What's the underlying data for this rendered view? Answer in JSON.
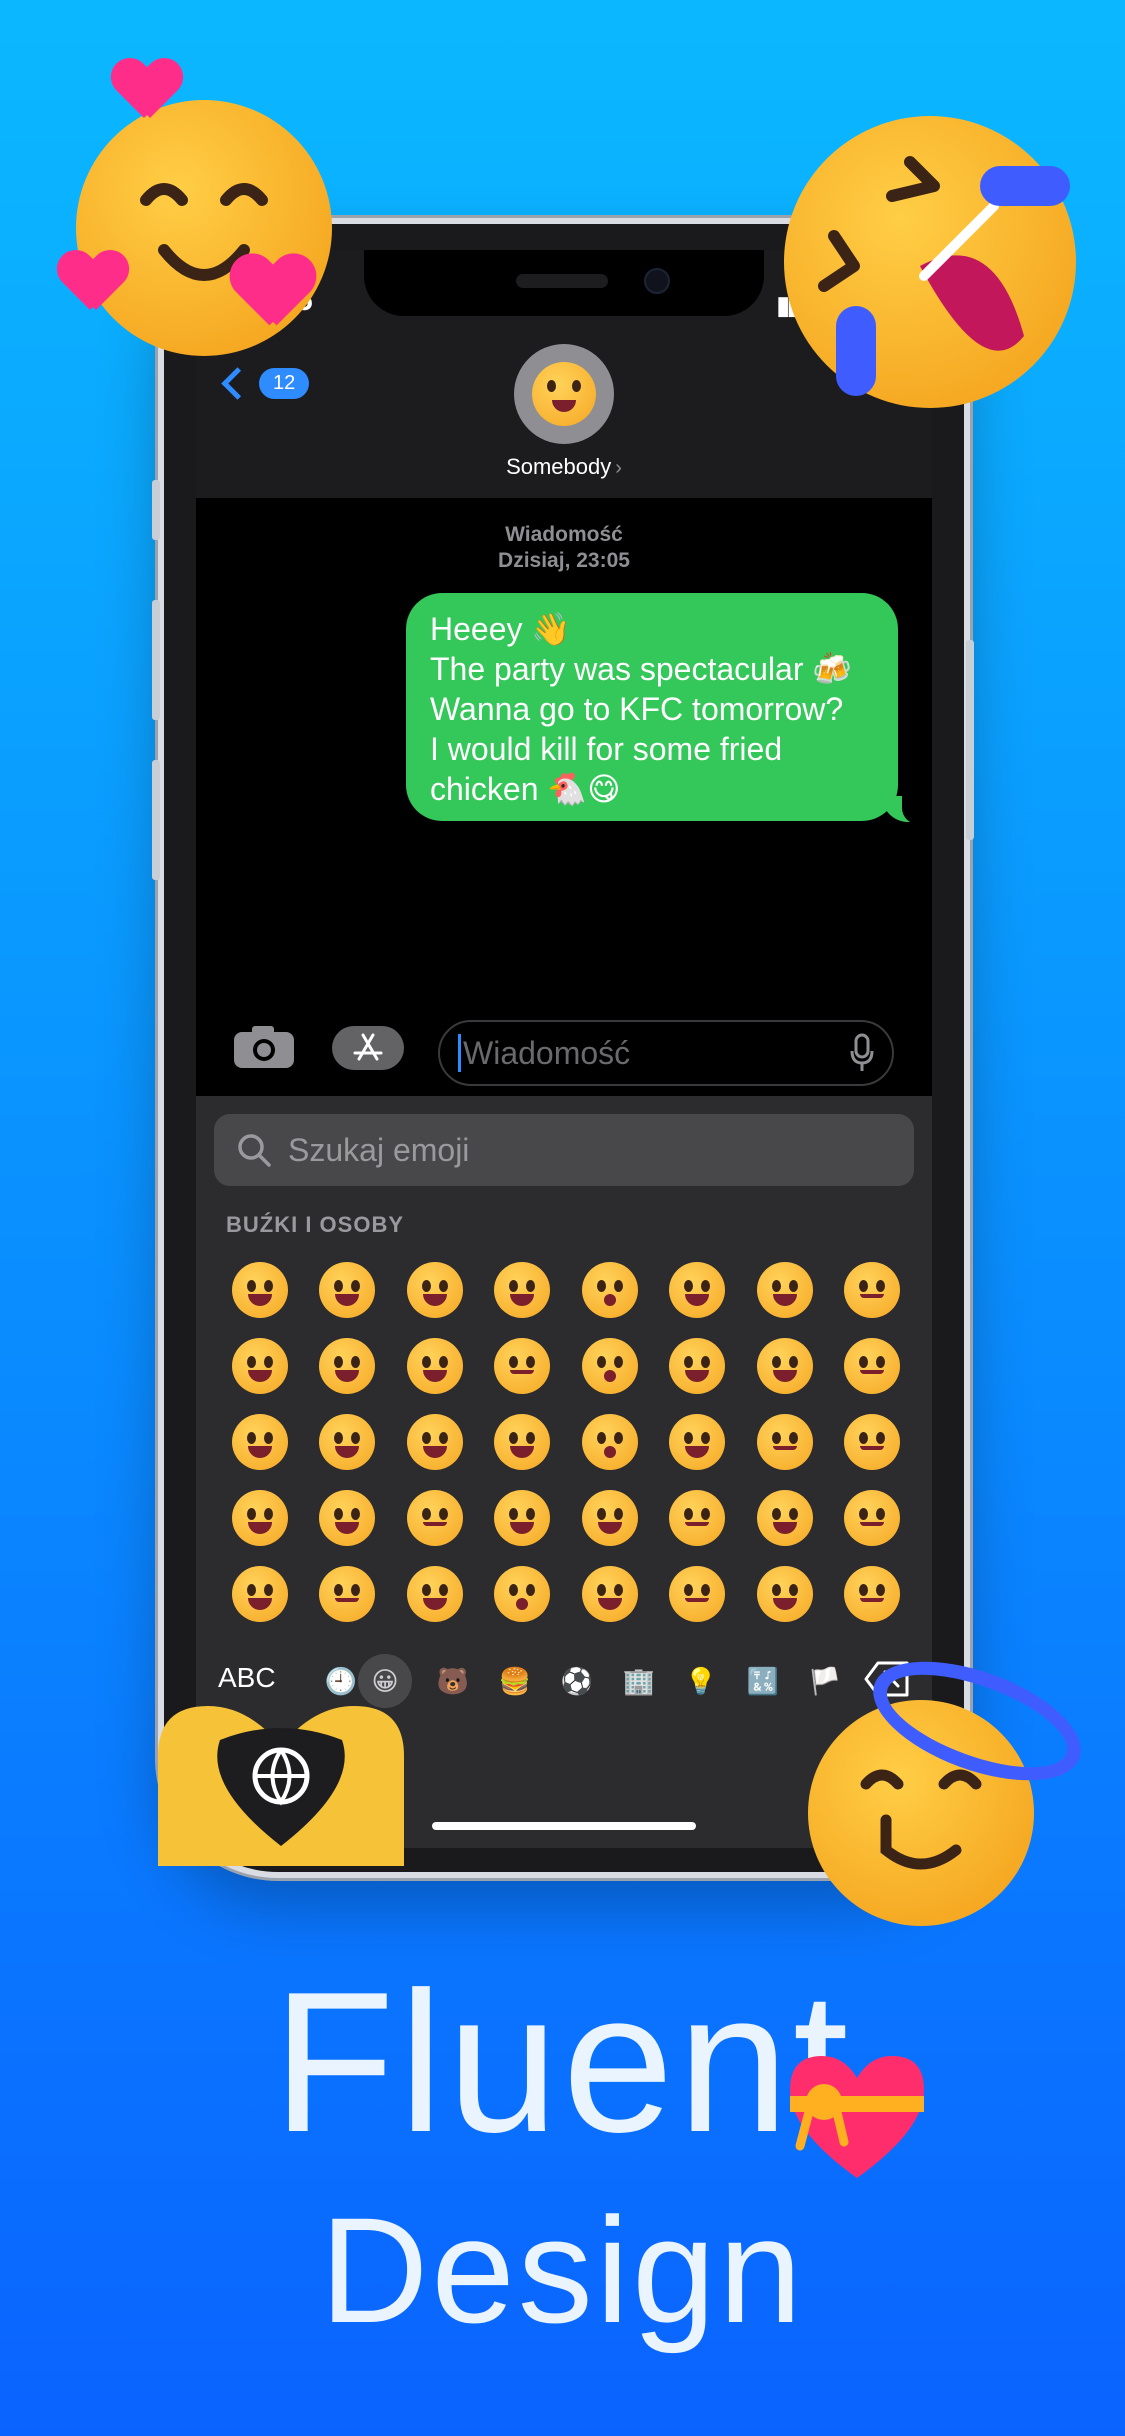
{
  "status": {
    "time": "5",
    "signal": "▮▮"
  },
  "header": {
    "back_badge": "12",
    "contact_name": "Somebody"
  },
  "conversation": {
    "meta_label": "Wiadomość",
    "meta_time": "Dzisiaj, 23:05",
    "message_lines": [
      "Heeey 👋",
      "The party was spectacular 🍻",
      "Wanna go to KFC tomorrow?",
      "I would kill for some fried",
      "chicken 🐔😋"
    ]
  },
  "input": {
    "placeholder": "Wiadomość"
  },
  "keyboard": {
    "search_placeholder": "Szukaj emoji",
    "category_title": "BUŹKI I OSOBY",
    "abc_label": "ABC",
    "emoji_rows": [
      [
        "😀",
        "🥹",
        "😊",
        "😉",
        "😗",
        "😝",
        "🤓",
        "🙄"
      ],
      [
        "😃",
        "😅",
        "☺️",
        "😌",
        "😙",
        "😜",
        "😎",
        "😒"
      ],
      [
        "😄",
        "😂",
        "😇",
        "😍",
        "😚",
        "🤪",
        "🥸",
        "😞"
      ],
      [
        "😁",
        "🤣",
        "🙂",
        "🥰",
        "😋",
        "🤨",
        "🤩",
        "😔"
      ],
      [
        "😆",
        "🥲",
        "🙃",
        "😘",
        "😛",
        "🧐",
        "🥳",
        "😟"
      ]
    ],
    "categories": [
      "🕘",
      "😀",
      "🐻",
      "🍔",
      "⚽",
      "🏢",
      "💡",
      "🔣",
      "🏳️"
    ]
  },
  "headline": {
    "line1": "Fluent",
    "line2": "Design"
  },
  "colors": {
    "accent": "#2f8cff",
    "bubble": "#34c759",
    "background_top": "#0bb8ff",
    "background_bottom": "#0a63ff"
  }
}
